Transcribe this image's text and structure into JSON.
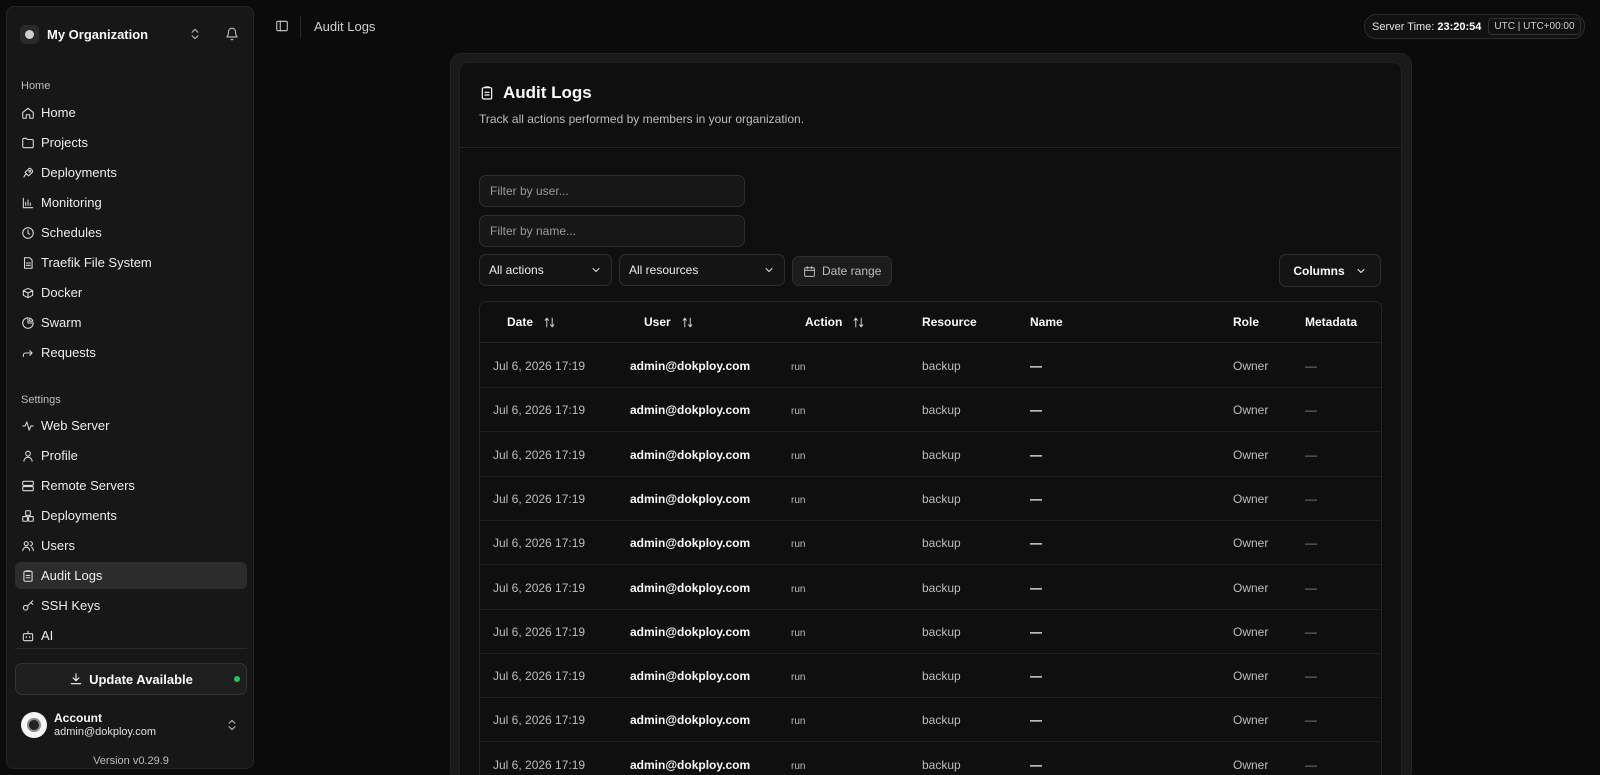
{
  "org": {
    "name": "My Organization"
  },
  "sidebar": {
    "home_label": "Home",
    "settings_label": "Settings",
    "home_items": [
      {
        "label": "Home",
        "icon": "home-icon"
      },
      {
        "label": "Projects",
        "icon": "folder-icon"
      },
      {
        "label": "Deployments",
        "icon": "rocket-icon"
      },
      {
        "label": "Monitoring",
        "icon": "chart-icon"
      },
      {
        "label": "Schedules",
        "icon": "clock-icon"
      },
      {
        "label": "Traefik File System",
        "icon": "file-icon"
      },
      {
        "label": "Docker",
        "icon": "box-icon"
      },
      {
        "label": "Swarm",
        "icon": "pie-icon"
      },
      {
        "label": "Requests",
        "icon": "forward-icon"
      }
    ],
    "settings_items": [
      {
        "label": "Web Server",
        "icon": "activity-icon"
      },
      {
        "label": "Profile",
        "icon": "user-icon"
      },
      {
        "label": "Remote Servers",
        "icon": "server-icon"
      },
      {
        "label": "Deployments",
        "icon": "boxes-icon"
      },
      {
        "label": "Users",
        "icon": "users-icon"
      },
      {
        "label": "Audit Logs",
        "icon": "clipboard-icon",
        "active": true
      },
      {
        "label": "SSH Keys",
        "icon": "key-icon"
      },
      {
        "label": "AI",
        "icon": "bot-icon"
      }
    ],
    "update_label": "Update Available",
    "account": {
      "name": "Account",
      "email": "admin@dokploy.com"
    },
    "version": "Version v0.29.9"
  },
  "topbar": {
    "breadcrumb": "Audit Logs",
    "server_time_label": "Server Time:",
    "server_time": "23:20:54",
    "timezone": "UTC | UTC+00:00"
  },
  "page": {
    "title": "Audit Logs",
    "subtitle": "Track all actions performed by members in your organization.",
    "filter_user_placeholder": "Filter by user...",
    "filter_name_placeholder": "Filter by name...",
    "actions_select": "All actions",
    "resources_select": "All resources",
    "date_range": "Date range",
    "columns_button": "Columns"
  },
  "table": {
    "headers": {
      "date": "Date",
      "user": "User",
      "action": "Action",
      "resource": "Resource",
      "name": "Name",
      "role": "Role",
      "metadata": "Metadata"
    },
    "rows": [
      {
        "date": "Jul 6, 2026 17:19",
        "user": "admin@dokploy.com",
        "action": "run",
        "resource": "backup",
        "name": "—",
        "role": "Owner",
        "metadata": "—"
      },
      {
        "date": "Jul 6, 2026 17:19",
        "user": "admin@dokploy.com",
        "action": "run",
        "resource": "backup",
        "name": "—",
        "role": "Owner",
        "metadata": "—"
      },
      {
        "date": "Jul 6, 2026 17:19",
        "user": "admin@dokploy.com",
        "action": "run",
        "resource": "backup",
        "name": "—",
        "role": "Owner",
        "metadata": "—"
      },
      {
        "date": "Jul 6, 2026 17:19",
        "user": "admin@dokploy.com",
        "action": "run",
        "resource": "backup",
        "name": "—",
        "role": "Owner",
        "metadata": "—"
      },
      {
        "date": "Jul 6, 2026 17:19",
        "user": "admin@dokploy.com",
        "action": "run",
        "resource": "backup",
        "name": "—",
        "role": "Owner",
        "metadata": "—"
      },
      {
        "date": "Jul 6, 2026 17:19",
        "user": "admin@dokploy.com",
        "action": "run",
        "resource": "backup",
        "name": "—",
        "role": "Owner",
        "metadata": "—"
      },
      {
        "date": "Jul 6, 2026 17:19",
        "user": "admin@dokploy.com",
        "action": "run",
        "resource": "backup",
        "name": "—",
        "role": "Owner",
        "metadata": "—"
      },
      {
        "date": "Jul 6, 2026 17:19",
        "user": "admin@dokploy.com",
        "action": "run",
        "resource": "backup",
        "name": "—",
        "role": "Owner",
        "metadata": "—"
      },
      {
        "date": "Jul 6, 2026 17:19",
        "user": "admin@dokploy.com",
        "action": "run",
        "resource": "backup",
        "name": "—",
        "role": "Owner",
        "metadata": "—"
      },
      {
        "date": "Jul 6, 2026 17:19",
        "user": "admin@dokploy.com",
        "action": "run",
        "resource": "backup",
        "name": "—",
        "role": "Owner",
        "metadata": "—"
      }
    ]
  },
  "colors": {
    "background": "#0b0b0b",
    "sidebar": "#171717",
    "update_dot": "#22c55e"
  }
}
